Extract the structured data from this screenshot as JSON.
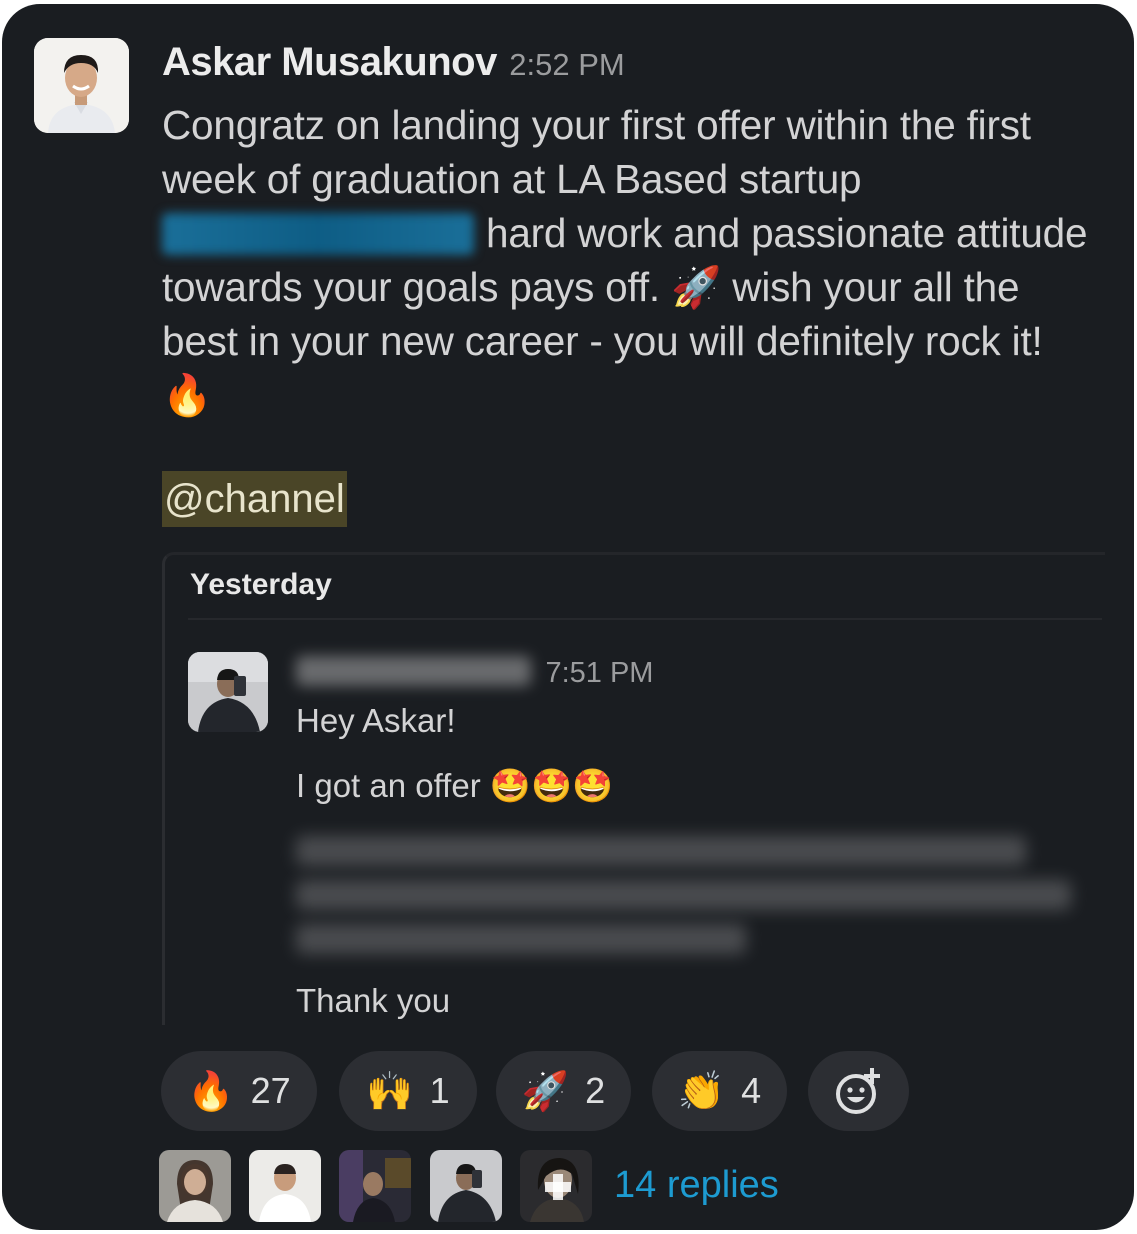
{
  "message": {
    "author": "Askar Musakunov",
    "time": "2:52 PM",
    "text_part1": "Congratz on landing your first offer within the first week of graduation at LA Based startup",
    "text_part2": "hard work and passionate attitude towards your goals pays off.",
    "emoji_rocket": "🚀",
    "text_part3": "wish your all the best in your new career - you will definitely rock it!",
    "emoji_fire": "🔥",
    "channel_mention": "@channel"
  },
  "quote": {
    "date_label": "Yesterday",
    "time": "7:51 PM",
    "line1": "Hey Askar!",
    "line2": "I got an offer",
    "line2_emojis": "🤩🤩🤩",
    "line_last": "Thank you"
  },
  "reactions": [
    {
      "emoji": "🔥",
      "count": "27",
      "icon": "fire-icon"
    },
    {
      "emoji": "🙌",
      "count": "1",
      "icon": "raised-hands-icon"
    },
    {
      "emoji": "🚀",
      "count": "2",
      "icon": "rocket-icon"
    },
    {
      "emoji": "👏",
      "count": "4",
      "icon": "clapping-hands-icon"
    }
  ],
  "add_reaction_icon": "add-emoji-icon",
  "replies": {
    "label": "14 replies"
  },
  "colors": {
    "background": "#1a1d21",
    "link": "#1d9bd1",
    "channel_highlight": "#4a4527"
  }
}
